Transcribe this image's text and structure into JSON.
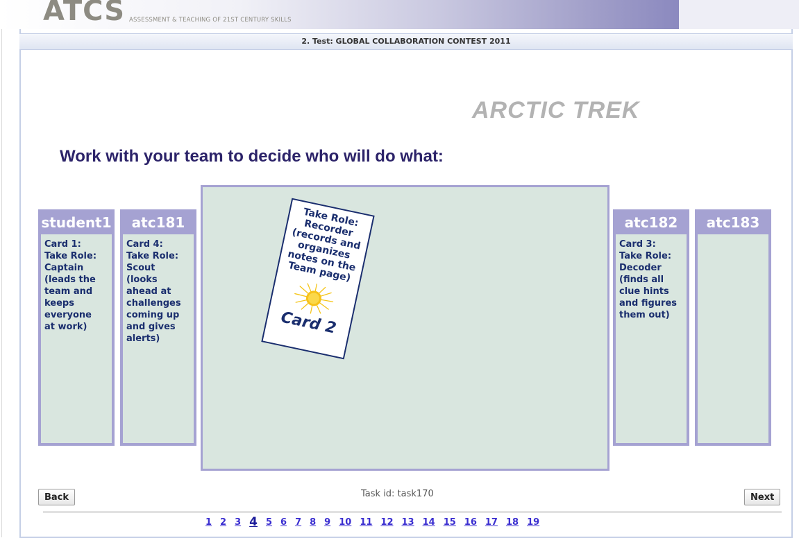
{
  "header": {
    "logo_text": "ATCS",
    "logo_sub": "ASSESSMENT & TEACHING OF 21ST CENTURY SKILLS"
  },
  "titlebar": "2. Test: GLOBAL COLLABORATION CONTEST 2011",
  "app_title": "ARCTIC TREK",
  "instruction": "Work with your team to decide who will do what:",
  "panels": [
    {
      "name": "student1",
      "lines": [
        "Card 1:",
        "Take Role:",
        "Captain",
        "(leads the",
        "team and",
        "keeps",
        "everyone",
        "at work)"
      ]
    },
    {
      "name": "atc181",
      "lines": [
        "Card 4:",
        "Take Role:",
        "Scout",
        "(looks",
        "ahead at",
        "challenges",
        "coming up",
        "and gives",
        "alerts)"
      ]
    },
    {
      "name": "atc182",
      "lines": [
        "Card 3:",
        "Take Role:",
        "Decoder",
        "(finds all",
        "clue hints",
        "and figures",
        "them out)"
      ]
    },
    {
      "name": "atc183",
      "lines": []
    }
  ],
  "card": {
    "lines": [
      "Take Role:",
      "Recorder",
      "(records and",
      "organizes",
      "notes on the",
      "Team page)"
    ],
    "label": "Card 2",
    "icon": "sun-icon",
    "sun_color": "#f5c518"
  },
  "controls": {
    "back_label": "Back",
    "next_label": "Next",
    "task_id": "Task id: task170"
  },
  "pager": {
    "pages": [
      "1",
      "2",
      "3",
      "4",
      "5",
      "6",
      "7",
      "8",
      "9",
      "10",
      "11",
      "12",
      "13",
      "14",
      "15",
      "16",
      "17",
      "18",
      "19"
    ],
    "current": "4"
  },
  "colors": {
    "accent": "#a5a2d2",
    "board": "#d9e6df",
    "text_dark": "#1a2e6e",
    "instruction": "#2c2369"
  }
}
